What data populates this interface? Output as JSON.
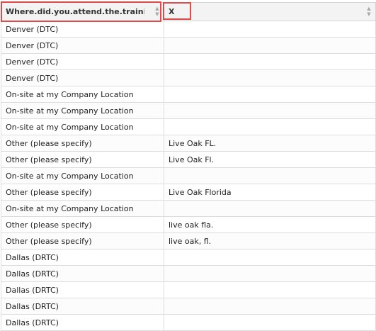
{
  "table": {
    "headers": [
      "Where.did.you.attend.the.training.course.",
      "X"
    ],
    "sort_icon": "sort-up-down-icon",
    "rows": [
      [
        "Denver (DTC)",
        ""
      ],
      [
        "Denver (DTC)",
        ""
      ],
      [
        "Denver (DTC)",
        ""
      ],
      [
        "Denver (DTC)",
        ""
      ],
      [
        "On-site at my Company Location",
        ""
      ],
      [
        "On-site at my Company Location",
        ""
      ],
      [
        "On-site at my Company Location",
        ""
      ],
      [
        "Other (please specify)",
        "Live Oak FL."
      ],
      [
        "Other (please specify)",
        "Live Oak Fl."
      ],
      [
        "On-site at my Company Location",
        ""
      ],
      [
        "Other (please specify)",
        "Live Oak Florida"
      ],
      [
        "On-site at my Company Location",
        ""
      ],
      [
        "Other (please specify)",
        "live oak fla."
      ],
      [
        "Other (please specify)",
        "live oak, fl."
      ],
      [
        "Dallas (DRTC)",
        ""
      ],
      [
        "Dallas (DRTC)",
        ""
      ],
      [
        "Dallas (DRTC)",
        ""
      ],
      [
        "Dallas (DRTC)",
        ""
      ],
      [
        "Dallas (DRTC)",
        ""
      ]
    ]
  },
  "colors": {
    "highlight": "#e04a4a",
    "header_bg": "#f3f3f3",
    "grid_line": "#dddddd"
  }
}
